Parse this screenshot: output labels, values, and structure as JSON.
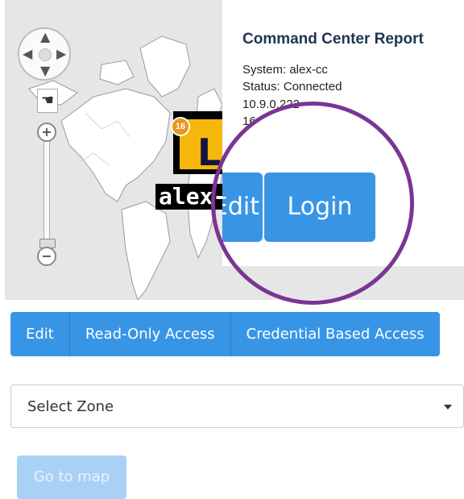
{
  "map": {
    "marker_count": "16",
    "marker_letter": "L",
    "marker_label": "alex-"
  },
  "map_controls": {
    "pan_icon": "pan-arrows-icon",
    "hand_icon": "hand-icon",
    "zoom_in_symbol": "+",
    "zoom_out_symbol": "−"
  },
  "popup": {
    "title": "Command Center Report",
    "system": "System: alex-cc",
    "status": "Status: Connected",
    "ip": "10.9.0.222",
    "extra": "16",
    "edit_label": "Edit",
    "login_label": "Login"
  },
  "access_buttons": [
    "Edit",
    "Read-Only Access",
    "Credential Based Access"
  ],
  "zone_select": {
    "value": "Select Zone"
  },
  "go_button": {
    "label": "Go to map"
  },
  "colors": {
    "primary": "#3895e6",
    "primary_disabled": "#a9d1f6",
    "highlight": "#7a3594",
    "marker": "#f5b80a",
    "title": "#1e3553"
  }
}
